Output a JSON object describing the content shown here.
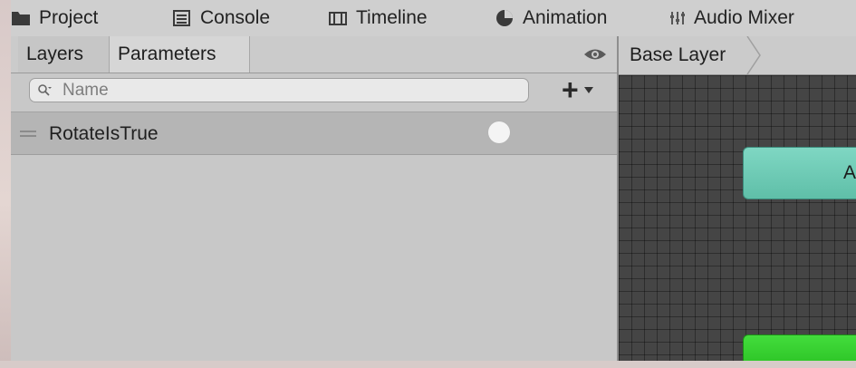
{
  "window_tabs": [
    {
      "label": "Project",
      "icon": "folder-icon"
    },
    {
      "label": "Console",
      "icon": "console-icon"
    },
    {
      "label": "Timeline",
      "icon": "timeline-icon"
    },
    {
      "label": "Animation",
      "icon": "animation-icon"
    },
    {
      "label": "Audio Mixer",
      "icon": "audio-mixer-icon"
    }
  ],
  "animator": {
    "panel_tabs": [
      {
        "label": "Layers"
      },
      {
        "label": "Parameters"
      }
    ],
    "active_panel_tab": "Parameters",
    "search": {
      "placeholder": "Name",
      "value": ""
    },
    "parameters": [
      {
        "name": "RotateIsTrue",
        "type": "bool",
        "value": false
      }
    ],
    "breadcrumb": "Base Layer",
    "nodes": [
      {
        "label": "A",
        "color": "#6fcbb5"
      },
      {
        "label": "",
        "color": "#33cc2b"
      }
    ]
  }
}
